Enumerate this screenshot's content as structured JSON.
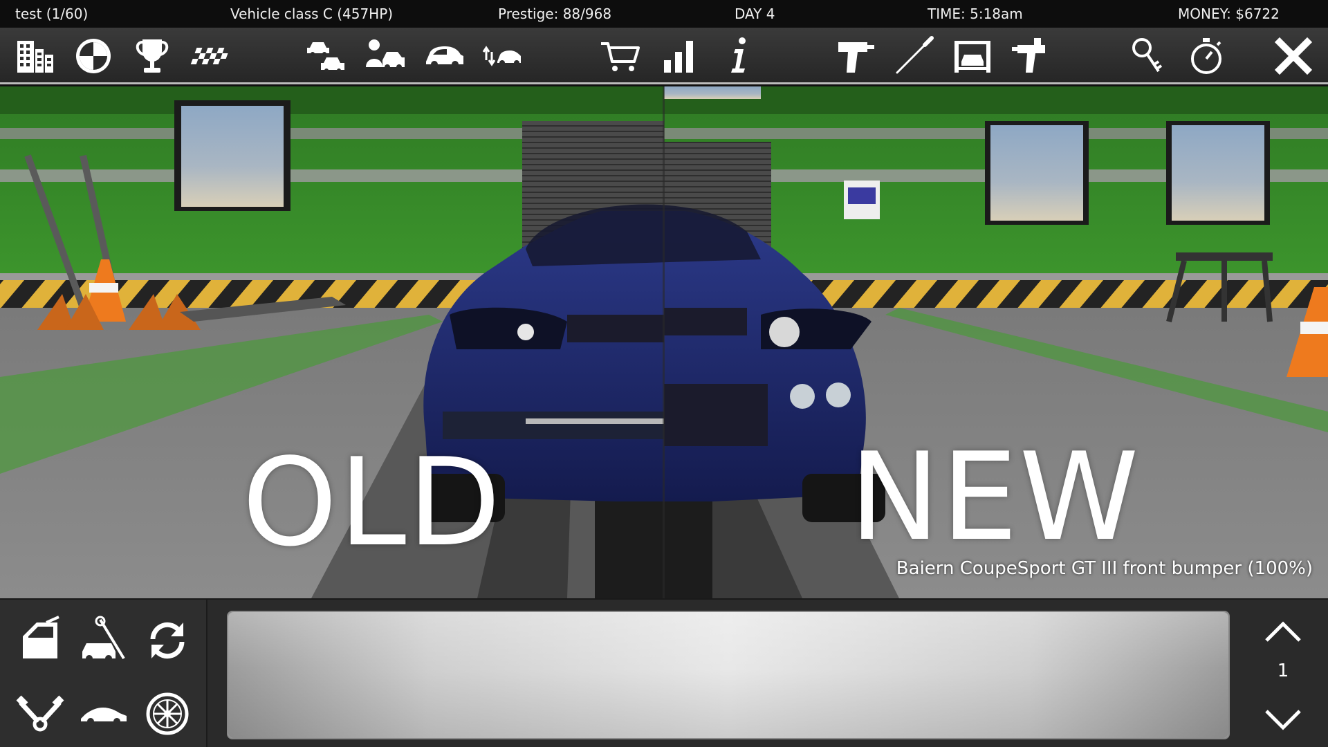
{
  "status": {
    "profile": "test (1/60)",
    "vehicle_class": "Vehicle class C (457HP)",
    "prestige": "Prestige: 88/968",
    "day": "DAY 4",
    "time": "TIME: 5:18am",
    "money": "MONEY: $6722"
  },
  "toolbar": {
    "icons": [
      "city-icon",
      "wheel-icon",
      "trophy-icon",
      "checkered-flag-icon",
      "car-swap-icon",
      "car-dealer-icon",
      "car-icon",
      "car-transfer-icon",
      "shopping-cart-icon",
      "stats-icon",
      "info-icon",
      "drill-icon",
      "screwdriver-icon",
      "car-lift-icon",
      "paint-gun-icon",
      "keys-icon",
      "stopwatch-icon",
      "close-icon"
    ]
  },
  "viewport": {
    "old_label": "OLD",
    "new_label": "NEW",
    "part_caption": "Baiern CoupeSport GT III front bumper (100%)"
  },
  "bottom": {
    "icons": [
      "car-door-icon",
      "car-repair-icon",
      "refresh-icon",
      "engine-icon",
      "car-body-icon",
      "rim-icon"
    ],
    "page": "1"
  },
  "colors": {
    "wall_green": "#3f8f2e",
    "car_blue": "#1e2a6e",
    "hazard_yellow": "#e0b23a",
    "cone_orange": "#ee7a1e"
  }
}
